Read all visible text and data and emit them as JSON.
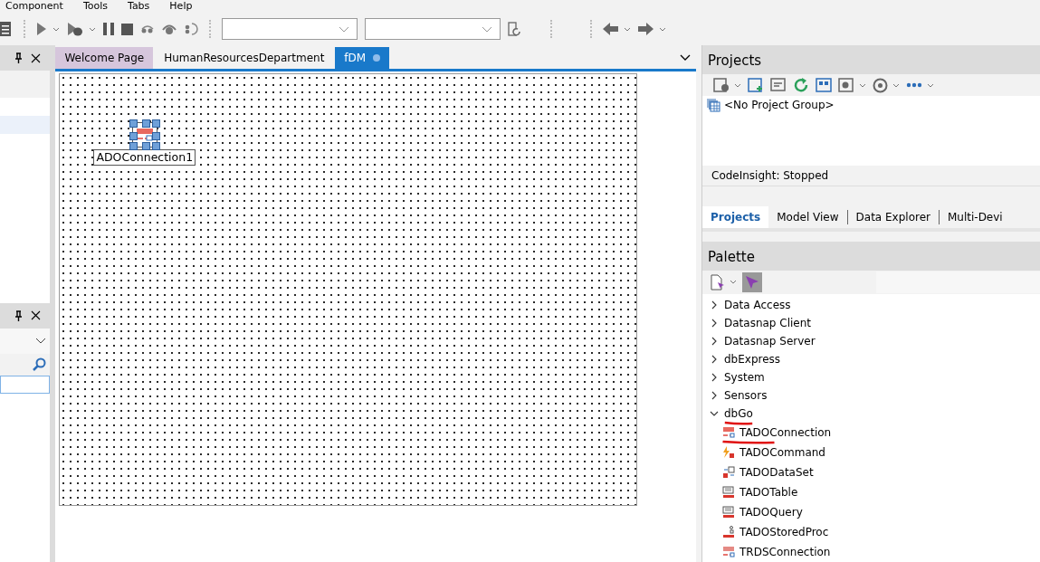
{
  "menu": [
    "Component",
    "Tools",
    "Tabs",
    "Help"
  ],
  "editor_tabs": [
    {
      "label": "Welcome Page",
      "kind": "welcome",
      "selected": false,
      "modified": false
    },
    {
      "label": "HumanResourcesDepartment",
      "kind": "file",
      "selected": false,
      "modified": false
    },
    {
      "label": "fDM",
      "kind": "file",
      "selected": true,
      "modified": true
    }
  ],
  "form": {
    "component": {
      "label": "ADOConnection1",
      "selected": true
    }
  },
  "projects": {
    "title": "Projects",
    "items": [
      "<No Project Group>"
    ],
    "status": "CodeInsight: Stopped",
    "tabs": [
      {
        "label": "Projects",
        "selected": true
      },
      {
        "label": "Model View",
        "selected": false
      },
      {
        "label": "Data Explorer",
        "selected": false
      },
      {
        "label": "Multi-Devi",
        "selected": false
      }
    ]
  },
  "palette": {
    "title": "Palette",
    "categories": [
      {
        "label": "Data Access",
        "expanded": false,
        "marked": false
      },
      {
        "label": "Datasnap Client",
        "expanded": false,
        "marked": false
      },
      {
        "label": "Datasnap Server",
        "expanded": false,
        "marked": false
      },
      {
        "label": "dbExpress",
        "expanded": false,
        "marked": false
      },
      {
        "label": "System",
        "expanded": false,
        "marked": false
      },
      {
        "label": "Sensors",
        "expanded": false,
        "marked": false
      },
      {
        "label": "dbGo",
        "expanded": true,
        "marked": true,
        "children": [
          {
            "label": "TADOConnection",
            "kind": "connection",
            "marked": true
          },
          {
            "label": "TADOCommand",
            "kind": "command",
            "marked": false
          },
          {
            "label": "TADODataSet",
            "kind": "dataset",
            "marked": false
          },
          {
            "label": "TADOTable",
            "kind": "table",
            "marked": false
          },
          {
            "label": "TADOQuery",
            "kind": "query",
            "marked": false
          },
          {
            "label": "TADOStoredProc",
            "kind": "storedproc",
            "marked": false
          },
          {
            "label": "TRDSConnection",
            "kind": "rds",
            "marked": false
          }
        ]
      }
    ]
  }
}
